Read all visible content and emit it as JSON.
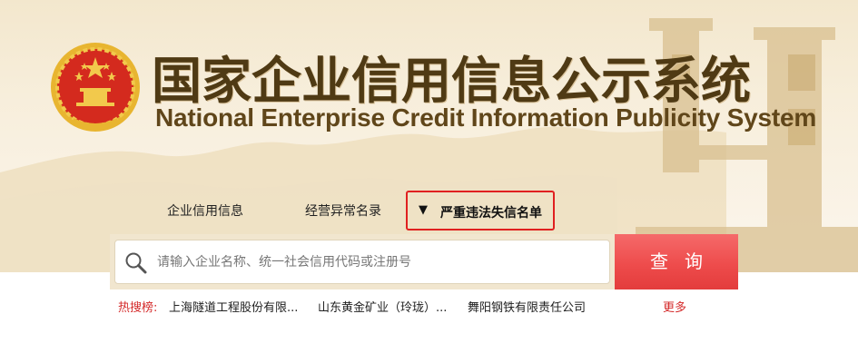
{
  "header": {
    "title_cn": "国家企业信用信息公示系统",
    "title_en": "National Enterprise Credit Information Publicity System",
    "emblem_icon": "national-emblem-icon"
  },
  "tabs": [
    {
      "label": "企业信用信息"
    },
    {
      "label": "经营异常名录"
    },
    {
      "label": "严重违法失信名单",
      "arrow": "▼",
      "active": true
    }
  ],
  "search": {
    "placeholder": "请输入企业名称、统一社会信用代码或注册号",
    "value": "",
    "button_label": "查询",
    "icon": "search-icon"
  },
  "hot_search": {
    "label": "热搜榜:",
    "items": [
      "上海隧道工程股份有限...",
      "山东黄金矿业（玲珑）...",
      "舞阳钢铁有限责任公司"
    ],
    "more_label": "更多"
  },
  "colors": {
    "accent_red": "#e02020",
    "button_red": "#ee4c4c",
    "title_brown": "#4f3a14",
    "hero_bg": "#f3e7cd"
  }
}
